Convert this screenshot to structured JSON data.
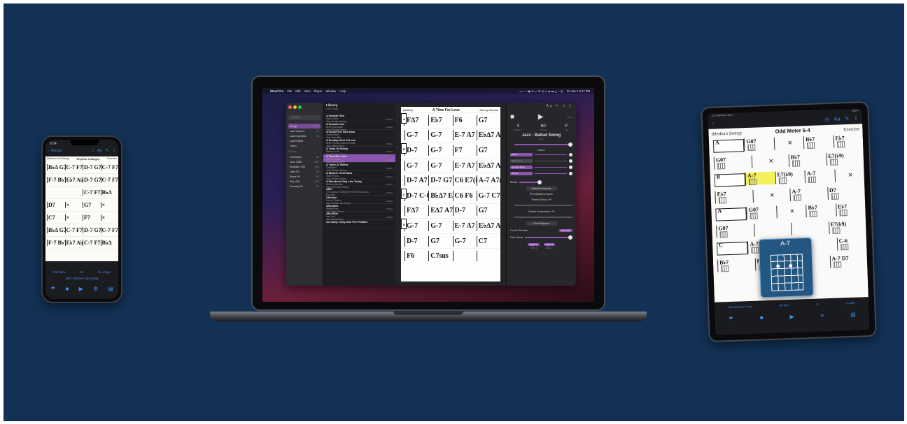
{
  "phone": {
    "status_time": "9:04",
    "nav": {
      "back": "Songs",
      "title": "Rhythm Changes",
      "icons": [
        "book-icon",
        "grid-icon",
        "text-size-icon",
        "pencil-icon",
        "share-icon"
      ]
    },
    "sheet": {
      "style": "(Medium Up Swing)",
      "title": "Rhythm Changes",
      "tag": "Exercise",
      "rows": [
        [
          "B♭Δ G7",
          "C-7 F7",
          "D-7 G7",
          "C-7 F7"
        ],
        [
          "F-7 B♭7",
          "E♭7 A♭7",
          "D-7 G7",
          "C-7 F7"
        ],
        [
          "",
          "",
          "C-7 F7",
          "B♭Δ"
        ],
        [
          "D7",
          "×",
          "G7",
          "×"
        ],
        [
          "C7",
          "×",
          "F7",
          "×"
        ],
        [
          "B♭Δ G7",
          "C-7 F7",
          "D-7 G7",
          "C-7 F7"
        ],
        [
          "F-7 B♭7",
          "E♭7 A♭7",
          "C-7 F7",
          "B♭Δ"
        ]
      ]
    },
    "footer": {
      "tempo": "100 bpm",
      "repeats": "3x",
      "key": "B♭ major",
      "style": "Jazz-Medium Up Swing"
    }
  },
  "laptop": {
    "menubar": {
      "app": "iReal Pro",
      "items": [
        "File",
        "Edit",
        "View",
        "Player",
        "Window",
        "Help"
      ],
      "clock": "Fri Jan 1  3:17 PM"
    },
    "sidebar": {
      "search_placeholder": "Search",
      "library_items": [
        {
          "label": "Songs",
          "count": "1978"
        },
        {
          "label": "Last Viewed",
          "count": "10"
        },
        {
          "label": "Last Imported",
          "count": "10"
        },
        {
          "label": "Last Edited",
          "count": ""
        },
        {
          "label": "Trash",
          "count": ""
        }
      ],
      "playlists_header": "Playlists",
      "playlists": [
        {
          "label": "Exercises",
          "count": "50"
        },
        {
          "label": "Jazz 1080",
          "count": "1080"
        },
        {
          "label": "Brazilian 150",
          "count": "150"
        },
        {
          "label": "Latin 50",
          "count": "50"
        },
        {
          "label": "Blues 50",
          "count": "50"
        },
        {
          "label": "Pop 400",
          "count": "400"
        },
        {
          "label": "Country 50",
          "count": "50"
        }
      ]
    },
    "songlist": {
      "title": "Library",
      "subtitle": "1978 Songs",
      "songs": [
        {
          "title": "A Sleepin' Bee",
          "sub": "Harold Arlen",
          "style": "Jazz-Medium Swing",
          "meta": "100bpm"
        },
        {
          "title": "A Smooth One",
          "sub": "Benny Goodman",
          "style": "Jazz-Medium Swing",
          "meta": "100bpm"
        },
        {
          "title": "A Sound For Sore Ears",
          "sub": "Jimmy Heath",
          "style": "Jazz-Even 8ths",
          "meta": ""
        },
        {
          "title": "A Sunday Kind Of Love",
          "sub": "Belle-Prima-Leonard-Rhodes",
          "style": "Jazz-Ballad Swing",
          "meta": "100bpm"
        },
        {
          "title": "A Taste Of Honey",
          "sub": "Marlow-Scott",
          "style": "Jazz-Medium Swing",
          "meta": "100bpm"
        },
        {
          "title": "A Time For Love",
          "sub": "Johnny Mandel",
          "style": "Jazz-Ballad Swing",
          "meta": "100bpm"
        },
        {
          "title": "A Token A Twelve",
          "sub": "Traditional",
          "style": "Jazz-Medium Swing",
          "meta": "100bpm"
        },
        {
          "title": "A Weaver Of Dreams",
          "sub": "Victor Young",
          "style": "Jazz-Medium Swing",
          "meta": "100bpm"
        },
        {
          "title": "A Wonderful Day Like Today",
          "sub": "Bricusse-Newley",
          "style": "Jazz-Up Tempo Swing",
          "meta": "100bpm"
        },
        {
          "title": "ABC",
          "sub": "The Jackson 5 (Mizell-Perren-Richards-Go...",
          "style": "Pop-RnB",
          "meta": "100bpm"
        },
        {
          "title": "Ablution",
          "sub": "Lennie Tristano",
          "style": "Jazz-Medium Up Swing 2",
          "meta": "100bpm"
        },
        {
          "title": "Afrocaine",
          "sub": "Rafael Ferro",
          "style": "Jazz-Ballad Even",
          "meta": "100bpm"
        },
        {
          "title": "Afro Blue",
          "sub": "Ivan Lins",
          "style": "Jazz-Bossa Nova",
          "meta": "100bpm"
        },
        {
          "title": "An Oarsy Ticky And The Positive",
          "sub": "",
          "style": "",
          "meta": ""
        }
      ],
      "selected_index": 5
    },
    "chart": {
      "style": "(Ballad)",
      "title": "A Time For Love",
      "composer": "Johnny Mandel",
      "rows": [
        [
          "F∆7",
          "E♭7",
          "F6",
          "G7"
        ],
        [
          "G-7",
          "G-7",
          "E-7 A7",
          "E♭∆7 A7(♭9)"
        ],
        [
          "D-7",
          "G-7",
          "F7",
          "G7"
        ],
        [
          "G-7",
          "G-7",
          "E-7 A7",
          "E♭∆7 A7(♭9)"
        ],
        [
          "D-7 A7",
          "D-7 G7",
          "C6 E7(♭9)",
          "A-7 A7(♭9)"
        ],
        [
          "D-7 C-6",
          "B♭∆7 E7",
          "C6 F6",
          "G-7 C7"
        ],
        [
          "F∆7",
          "E∆7 A7(♭9)",
          "D-7",
          "G7"
        ],
        [
          "G-7",
          "G-7",
          "E-7 A7",
          "E♭∆7 A7(♭9)"
        ],
        [
          "D-7",
          "G7",
          "G-7",
          "C7"
        ],
        [
          "F6",
          "C7sus",
          "",
          ""
        ]
      ]
    },
    "inspector": {
      "time": "00:05",
      "repeats": "3",
      "repeats_label": "Repeats",
      "tempo": "60",
      "tempo_label": "Tempo",
      "key": "F",
      "key_label": "Key",
      "style": "Jazz - Ballad Swing",
      "style_label": "Style",
      "volume_label": "Volume",
      "instruments": [
        "Piano",
        "Harmonica",
        "Acoustic Bass",
        "Drums"
      ],
      "reverb_label": "Reverb",
      "default_btn": "Default Instruments",
      "embellished": "Embellished Chords",
      "practice_tempo": "Practice Tempo: Off",
      "practice_transposition": "Practice Transposition: Off",
      "chord_diagrams_btn": "Chord Diagrams",
      "count_in_label": "Count In Duration",
      "count_in_value": "Automatic",
      "click_volume_label": "Click Volume",
      "click_1": "Digital 1",
      "click_2": "Digital 2",
      "click_1_label": "Click 1",
      "click_2_label": "Click 2"
    }
  },
  "tablet": {
    "status_time": "3:17 PM  Mon Jan 1",
    "battery": "100%",
    "sheet": {
      "style": "(Medium Swing)",
      "title": "Odd Meter 5-4",
      "tag": "Exercise",
      "rows": [
        [
          "G07",
          "×",
          "B♭7",
          "E♭7"
        ],
        [
          "G07",
          "×",
          "B♭7",
          "E7(♭9)"
        ],
        [
          "A-7",
          "E7(♭9)",
          "A-7",
          "×"
        ],
        [
          "E♭7",
          "×",
          "A-7",
          "D7"
        ],
        [
          "G07",
          "×",
          "B♭7",
          "E♭7"
        ],
        [
          "G07",
          "",
          "",
          "E7(♭9)"
        ],
        [
          "A-7",
          "",
          "",
          "C-6"
        ],
        [
          "B♭7",
          "B♭6",
          "",
          "A-7 D7"
        ]
      ]
    },
    "popup_chord": "A-7",
    "footer": {
      "style": "Jazz-Medium Swing",
      "tempo": "100 bpm",
      "repeats": "3x",
      "key": "G major"
    }
  },
  "colors": {
    "background": "#123155",
    "accent": "#8d55b2",
    "ios_blue": "#3d8ef0"
  }
}
